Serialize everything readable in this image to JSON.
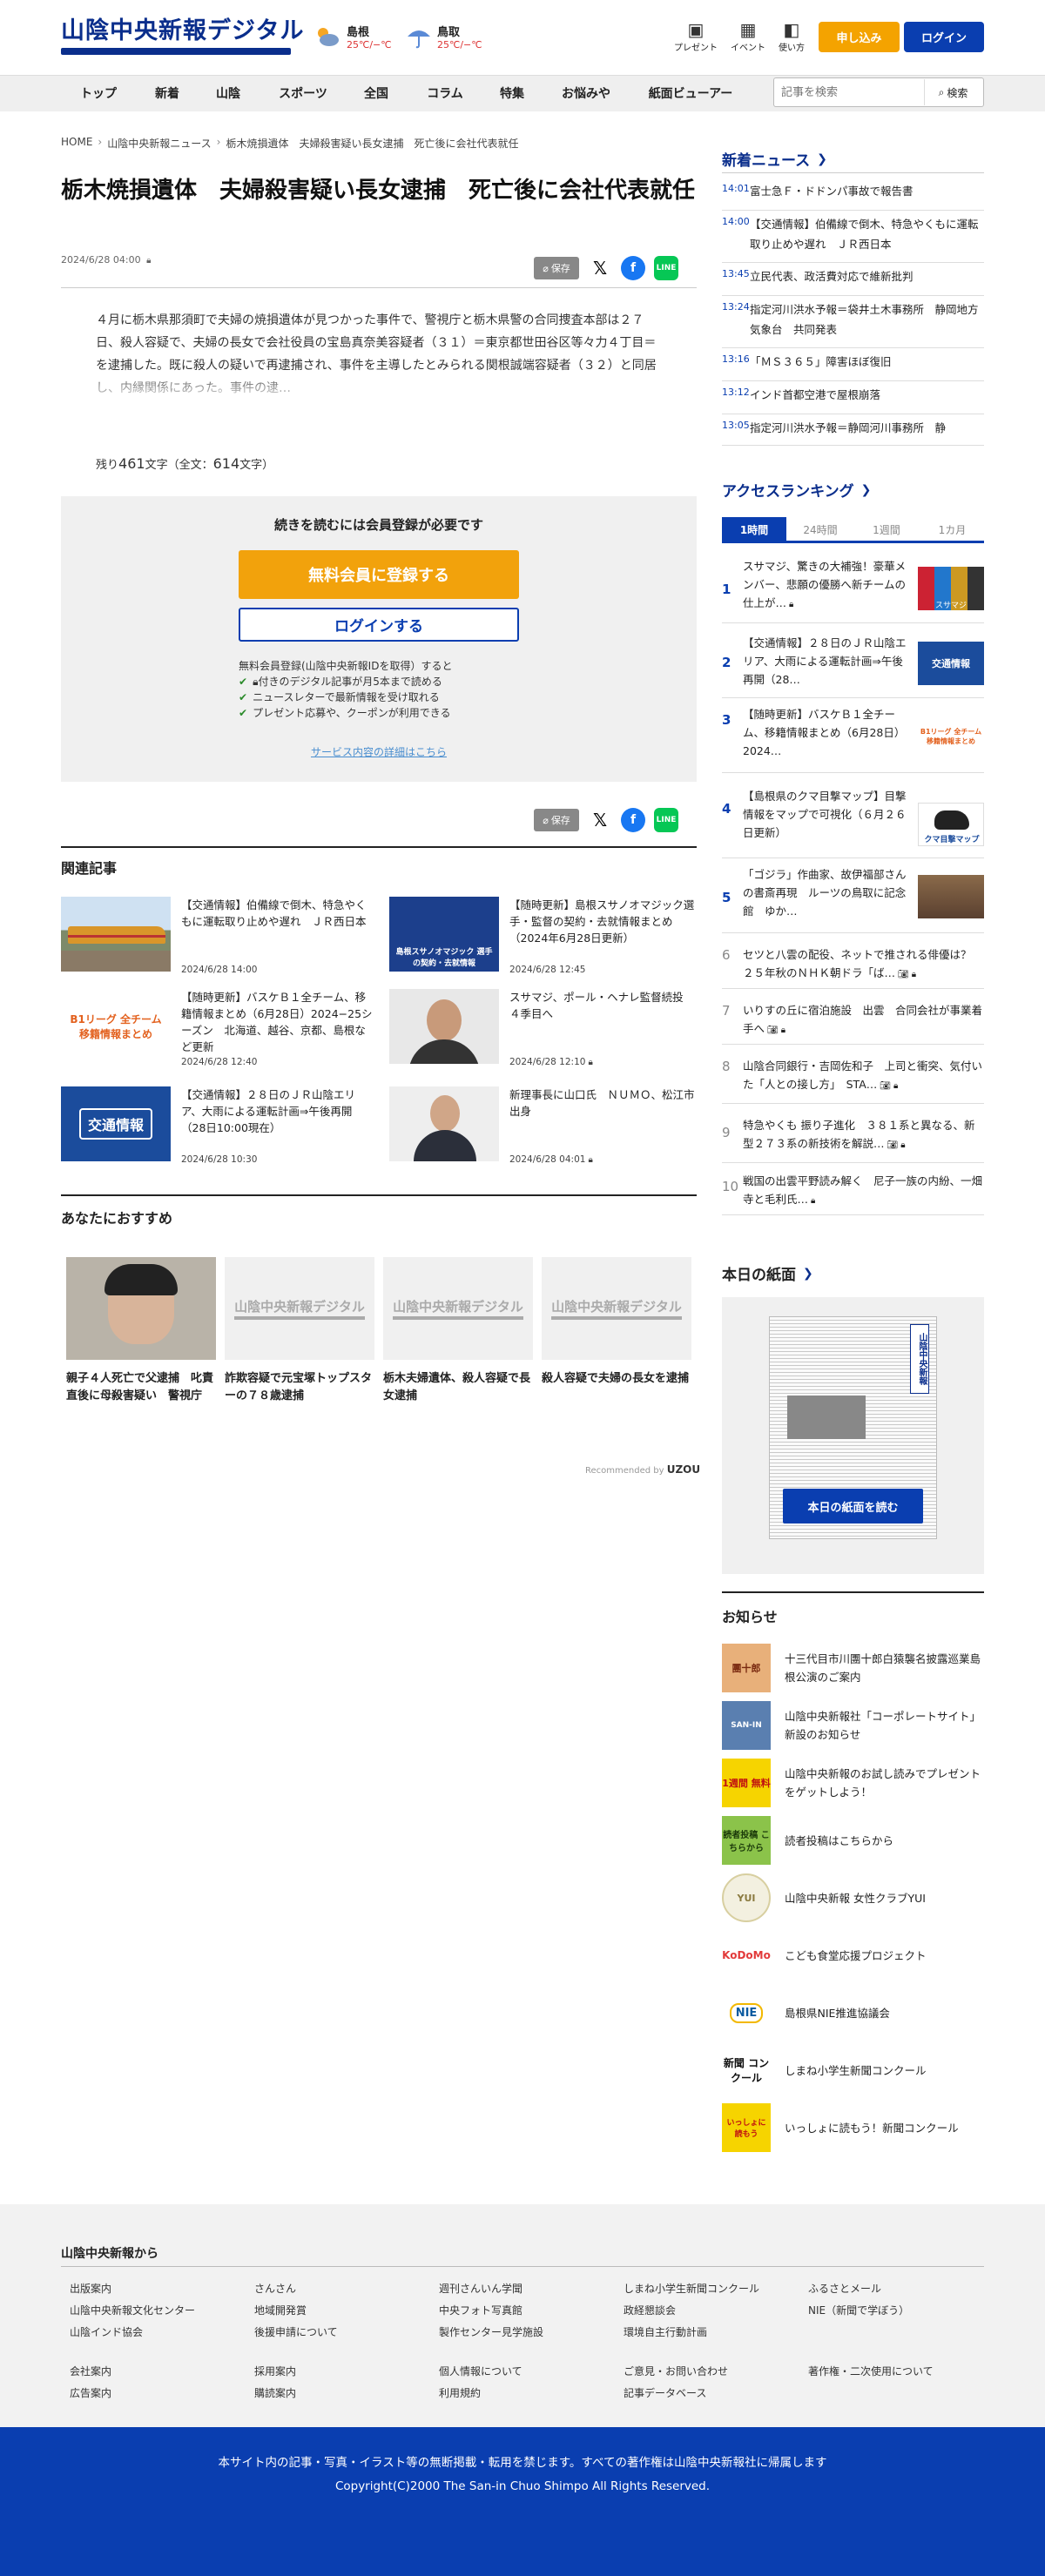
{
  "header": {
    "logo": "山陰中央新報デジタル",
    "weather": [
      {
        "city": "島根",
        "temp": "25℃/−℃",
        "icon": "sun-cloud-icon"
      },
      {
        "city": "鳥取",
        "temp": "25℃/−℃",
        "icon": "umbrella-icon"
      }
    ],
    "icons": [
      {
        "label": "プレゼント",
        "icon": "gift-icon"
      },
      {
        "label": "イベント",
        "icon": "calendar-icon"
      },
      {
        "label": "使い方",
        "icon": "book-icon"
      }
    ],
    "subscribe": "申し込み",
    "login": "ログイン"
  },
  "nav": {
    "items": [
      "トップ",
      "新着",
      "山陰",
      "スポーツ",
      "全国",
      "コラム",
      "特集",
      "お悩みや",
      "紙面ビューアー"
    ],
    "search_placeholder": "記事を検索",
    "search_button": "検索"
  },
  "article": {
    "breadcrumb": [
      "HOME",
      "山陰中央新報ニュース",
      "栃木焼損遺体　夫婦殺害疑い長女逮捕　死亡後に会社代表就任"
    ],
    "title": "栃木焼損遺体　夫婦殺害疑い長女逮捕　死亡後に会社代表就任",
    "date": "2024/6/28 04:00",
    "save": "保存",
    "body": "４月に栃木県那須町で夫婦の焼損遺体が見つかった事件で、警視庁と栃木県警の合同捜査本部は２７日、殺人容疑で、夫婦の長女で会社役員の宝島真奈美容疑者（３１）＝東京都世田谷区等々力４丁目＝を逮捕した。既に殺人の疑いで再逮捕され、事件を主導したとみられる関根誠端容疑者（３２）と同居し、内縁関係にあった。事件の逮…",
    "remain_prefix": "残り",
    "remain_count": "461",
    "remain_mid": "文字（全文：",
    "total_count": "614",
    "remain_suffix": "文字）"
  },
  "paywall": {
    "heading": "続きを読むには会員登録が必要です",
    "register": "無料会員に登録する",
    "login": "ログインする",
    "note": "無料会員登録(山陰中央新報IDを取得）すると",
    "benefits": [
      "付きのデジタル記事が月5本まで読める",
      "ニュースレターで最新情報を受け取れる",
      "プレゼント応募や、クーポンが利用できる"
    ],
    "link": "サービス内容の詳細はこちら"
  },
  "related": {
    "heading": "関連記事",
    "items": [
      {
        "title": "【交通情報】伯備線で倒木、特急やくもに運転取り止めや遅れ　ＪＲ西日本",
        "date": "2024/6/28 14:00"
      },
      {
        "title": "【随時更新】島根スサノオマジック選手・監督の契約・去就情報まとめ（2024年6月28日更新）",
        "date": "2024/6/28 12:45"
      },
      {
        "title": "【随時更新】バスケＢ１全チーム、移籍情報まとめ（6月28日）2024−25シーズン　北海道、越谷、京都、島根など更新",
        "date": "2024/6/28 12:40"
      },
      {
        "title": "スサマジ、ポール・ヘナレ監督続投　４季目へ",
        "date": "2024/6/28 12:10"
      },
      {
        "title": "【交通情報】２８日のＪＲ山陰エリア、大雨による運転計画⇒午後再開（28日10:00現在）",
        "date": "2024/6/28 10:30"
      },
      {
        "title": "新理事長に山口氏　ＮＵＭＯ、松江市出身",
        "date": "2024/6/28 04:01"
      }
    ],
    "thumb_text": {
      "transit": "交通情報",
      "b1": "B1リーグ 全チーム移籍情報まとめ",
      "susanoo": "島根スサノオマジック 選手の契約・去就情報"
    }
  },
  "recommend": {
    "heading": "あなたにおすすめ",
    "placeholder_logo": "山陰中央新報デジタル",
    "items": [
      {
        "caption": "親子４人死亡で父逮捕　叱責直後に母殺害疑い　警視庁"
      },
      {
        "caption": "詐欺容疑で元宝塚トップスターの７８歳逮捕"
      },
      {
        "caption": "栃木夫婦遺体、殺人容疑で長女逮捕"
      },
      {
        "caption": "殺人容疑で夫婦の長女を逮捕"
      }
    ],
    "powered_prefix": "Recommended by",
    "powered_brand": "UZOU"
  },
  "sidebar": {
    "news_heading": "新着ニュース",
    "news": [
      {
        "time": "14:01",
        "title": "富士急Ｆ・ドドンパ事故で報告書"
      },
      {
        "time": "14:00",
        "title": "【交通情報】伯備線で倒木、特急やくもに運転取り止めや遅れ　ＪＲ西日本"
      },
      {
        "time": "13:45",
        "title": "立民代表、政活費対応で維新批判"
      },
      {
        "time": "13:24",
        "title": "指定河川洪水予報＝袋井土木事務所　静岡地方気象台　共同発表"
      },
      {
        "time": "13:16",
        "title": "「ＭＳ３６５」障害ほぼ復旧"
      },
      {
        "time": "13:12",
        "title": "インド首都空港で屋根崩落"
      },
      {
        "time": "13:05",
        "title": "指定河川洪水予報＝静岡河川事務所　静"
      }
    ],
    "ranking_heading": "アクセスランキング",
    "tabs": [
      "1時間",
      "24時間",
      "1週間",
      "1カ月"
    ],
    "ranking": [
      {
        "rank": "1",
        "title": "スサマジ、驚きの大補強！豪華メンバー、悲願の優勝へ新チームの仕上が…"
      },
      {
        "rank": "2",
        "title": "【交通情報】２８日のＪＲ山陰エリア、大雨による運転計画⇒午後再開（28…"
      },
      {
        "rank": "3",
        "title": "【随時更新】バスケＢ１全チーム、移籍情報まとめ（6月28日）　2024…"
      },
      {
        "rank": "4",
        "title": "【島根県のクマ目撃マップ】目撃情報をマップで可視化（６月２６日更新）"
      },
      {
        "rank": "5",
        "title": "「ゴジラ」作曲家、故伊福部さんの書斎再現　ルーツの鳥取に記念館　ゆか…"
      },
      {
        "rank": "6",
        "title": "セツと八雲の配役、ネットで推される俳優は？　２５年秋のＮＨＫ朝ドラ「ば…"
      },
      {
        "rank": "7",
        "title": "いりすの丘に宿泊施設　出雲　合同会社が事業着手へ"
      },
      {
        "rank": "8",
        "title": "山陰合同銀行・吉岡佐和子　上司と衝突、気付いた「人との接し方」　STA…"
      },
      {
        "rank": "9",
        "title": "特急やくも 振り子進化　３８１系と異なる、新型２７３系の新技術を解説…"
      },
      {
        "rank": "10",
        "title": "戦国の出雲平野読み解く　尼子一族の内紛、一畑寺と毛利氏…"
      }
    ],
    "ranking_thumbs": {
      "susamaji": "スサマジ",
      "transit": "交通情報",
      "b1": "B1リーグ 全チーム移籍情報まとめ",
      "bear": "クマ目撃マップ"
    },
    "paper_heading": "本日の紙面",
    "paper_button": "本日の紙面を読む",
    "paper_masthead": "山陰中央新報",
    "info_heading": "お知らせ",
    "info": [
      {
        "title": "十三代目市川團十郎白猿襲名披露巡業島根公演のご案内",
        "icon_text": "團十郎"
      },
      {
        "title": "山陰中央新報社「コーポレートサイト」新設のお知らせ",
        "icon_text": "SAN-IN"
      },
      {
        "title": "山陰中央新報のお試し読みでプレゼントをゲットしよう！",
        "icon_text": "1週間 無料"
      },
      {
        "title": "読者投稿はこちらから",
        "icon_text": "読者投稿 こちらから"
      },
      {
        "title": "山陰中央新報 女性クラブYUI",
        "icon_text": "YUI"
      },
      {
        "title": "こども食堂応援プロジェクト",
        "icon_text": "KoDoMo"
      },
      {
        "title": "島根県NIE推進協議会",
        "icon_text": "NIE"
      },
      {
        "title": "しまね小学生新聞コンクール",
        "icon_text": "新聞 コンクール"
      },
      {
        "title": "いっしょに読もう！新聞コンクール",
        "icon_text": "いっしょに 読もう"
      }
    ]
  },
  "footer": {
    "heading": "山陰中央新報から",
    "links_row1": [
      "出版案内",
      "さんさん",
      "週刊さんいん学聞",
      "しまね小学生新聞コンクール",
      "ふるさとメール"
    ],
    "links_row2": [
      "山陰中央新報文化センター",
      "地域開発賞",
      "中央フォト写真館",
      "政経懇談会",
      "NIE（新聞で学ぼう）"
    ],
    "links_row3": [
      "山陰インド協会",
      "後援申請について",
      "製作センター見学施設",
      "環境自主行動計画"
    ],
    "links_row4": [
      "会社案内",
      "採用案内",
      "個人情報について",
      "ご意見・お問い合わせ",
      "著作権・二次使用について"
    ],
    "links_row5": [
      "広告案内",
      "購読案内",
      "利用規約",
      "記事データベース"
    ],
    "notice": "本サイト内の記事・写真・イラスト等の無断掲載・転用を禁じます。すべての著作権は山陰中央新報社に帰属します",
    "copyright": "Copyright(C)2000 The San-in Chuo Shimpo All Rights Reserved."
  }
}
